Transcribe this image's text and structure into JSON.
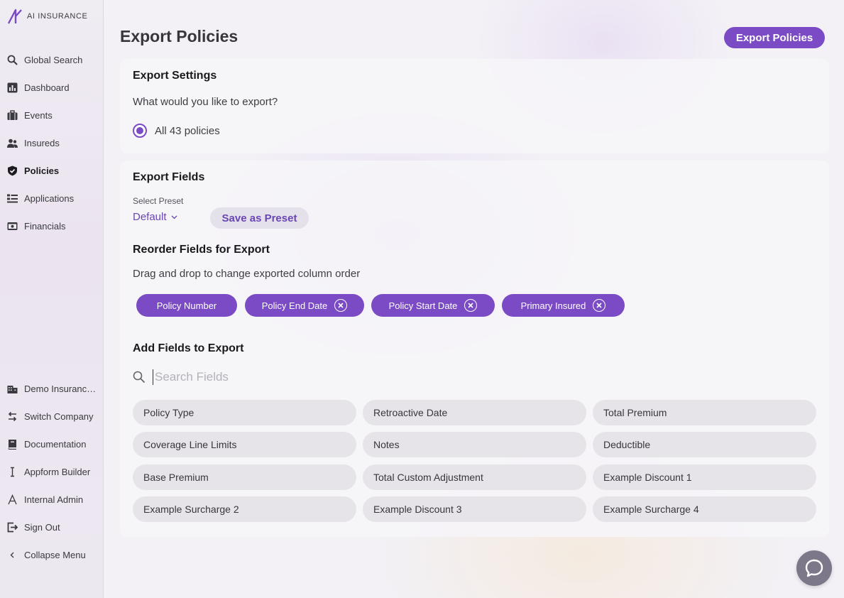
{
  "brand": {
    "name": "AI INSURANCE",
    "accent": "#7a4bc4"
  },
  "nav": {
    "top": [
      {
        "label": "Global Search",
        "icon": "search-icon"
      },
      {
        "label": "Dashboard",
        "icon": "chart-icon"
      },
      {
        "label": "Events",
        "icon": "briefcase-icon"
      },
      {
        "label": "Insureds",
        "icon": "people-icon"
      },
      {
        "label": "Policies",
        "icon": "shield-check-icon",
        "active": true
      },
      {
        "label": "Applications",
        "icon": "list-icon"
      },
      {
        "label": "Financials",
        "icon": "cash-icon"
      }
    ],
    "bottom": [
      {
        "label": "Demo Insurance Co",
        "icon": "building-icon"
      },
      {
        "label": "Switch Company",
        "icon": "swap-icon"
      },
      {
        "label": "Documentation",
        "icon": "book-icon"
      },
      {
        "label": "Appform Builder",
        "icon": "text-cursor-icon"
      },
      {
        "label": "Internal Admin",
        "icon": "letter-a-icon"
      },
      {
        "label": "Sign Out",
        "icon": "sign-out-icon"
      },
      {
        "label": "Collapse Menu",
        "icon": "chevron-left-icon"
      }
    ]
  },
  "header": {
    "title": "Export Policies",
    "export_button": "Export Policies"
  },
  "settings": {
    "heading": "Export Settings",
    "question": "What would you like to export?",
    "option_label": "All 43 policies"
  },
  "fields": {
    "heading": "Export Fields",
    "preset_label": "Select Preset",
    "preset_value": "Default",
    "save_preset": "Save as Preset",
    "reorder_heading": "Reorder Fields for Export",
    "reorder_hint": "Drag and drop to change exported column order",
    "selected": [
      {
        "label": "Policy Number",
        "removable": false
      },
      {
        "label": "Policy End Date",
        "removable": true
      },
      {
        "label": "Policy Start Date",
        "removable": true
      },
      {
        "label": "Primary Insured",
        "removable": true
      }
    ],
    "add_heading": "Add Fields to Export",
    "search_placeholder": "Search Fields",
    "available": [
      "Policy Type",
      "Retroactive Date",
      "Total Premium",
      "Coverage Line Limits",
      "Notes",
      "Deductible",
      "Base Premium",
      "Total Custom Adjustment",
      "Example Discount 1",
      "Example Surcharge 2",
      "Example Discount 3",
      "Example Surcharge 4"
    ]
  }
}
